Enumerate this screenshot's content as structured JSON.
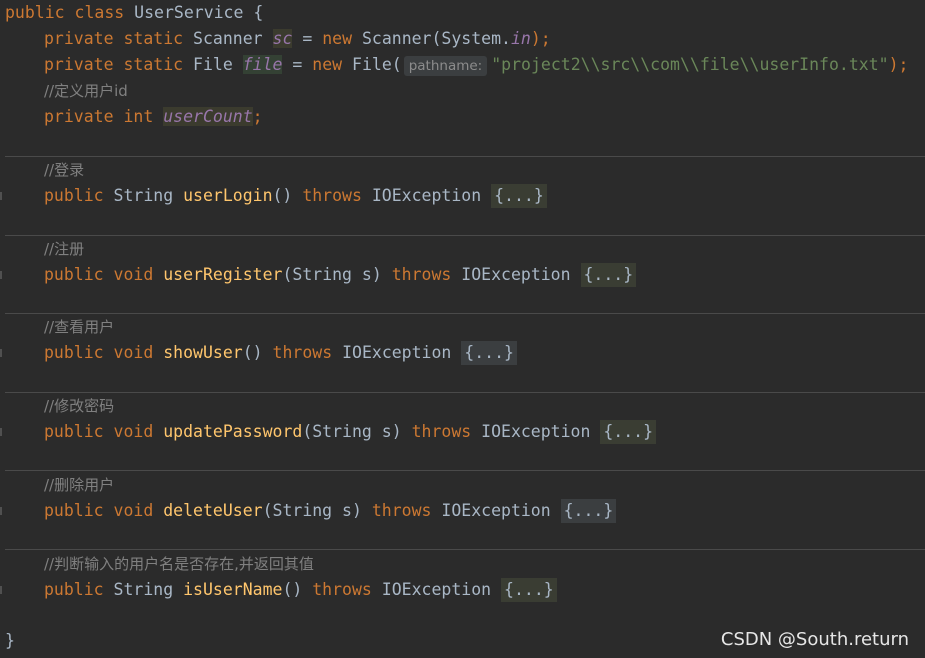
{
  "code": {
    "class_decl": {
      "kw1": "public",
      "kw2": "class",
      "name": "UserService",
      "brace": "{"
    },
    "field_sc": {
      "kw1": "private",
      "kw2": "static",
      "type": "Scanner",
      "var": "sc",
      "eq": "=",
      "kw3": "new",
      "ctor": "Scanner(System.",
      "in": "in",
      "end": ");"
    },
    "field_file": {
      "kw1": "private",
      "kw2": "static",
      "type": "File",
      "var": "file",
      "eq": "=",
      "kw3": "new",
      "ctor": "File(",
      "hint": "pathname:",
      "str": "\"project2\\\\src\\\\com\\\\file\\\\userInfo.txt\"",
      "end": ");"
    },
    "comment_id": "//定义用户id",
    "field_count": {
      "kw1": "private",
      "kw2": "int",
      "var": "userCount",
      "semi": ";"
    },
    "methods": [
      {
        "comment": "//登录",
        "mod": "public",
        "ret": "String",
        "name": "userLogin",
        "params": "()",
        "throws": "throws",
        "exc": "IOException",
        "body": "{...}"
      },
      {
        "comment": "//注册",
        "mod": "public",
        "ret": "void",
        "name": "userRegister",
        "params": "(String s)",
        "throws": "throws",
        "exc": "IOException",
        "body": "{...}"
      },
      {
        "comment": "//查看用户",
        "mod": "public",
        "ret": "void",
        "name": "showUser",
        "params": "()",
        "throws": "throws",
        "exc": "IOException",
        "body": "{...}"
      },
      {
        "comment": "//修改密码",
        "mod": "public",
        "ret": "void",
        "name": "updatePassword",
        "params": "(String s)",
        "throws": "throws",
        "exc": "IOException",
        "body": "{...}"
      },
      {
        "comment": "//删除用户",
        "mod": "public",
        "ret": "void",
        "name": "deleteUser",
        "params": "(String s)",
        "throws": "throws",
        "exc": "IOException",
        "body": "{...}"
      },
      {
        "comment": "//判断输入的用户名是否存在,并返回其值",
        "mod": "public",
        "ret": "String",
        "name": "isUserName",
        "params": "()",
        "throws": "throws",
        "exc": "IOException",
        "body": "{...}"
      }
    ],
    "closing_brace": "}"
  },
  "watermark": "CSDN @South.return",
  "colors": {
    "background": "#2b2b2b",
    "keyword": "#cc7832",
    "function": "#ffc66d",
    "string": "#6a8759",
    "comment": "#808080",
    "static_field": "#9876aa",
    "text": "#a9b7c6"
  }
}
